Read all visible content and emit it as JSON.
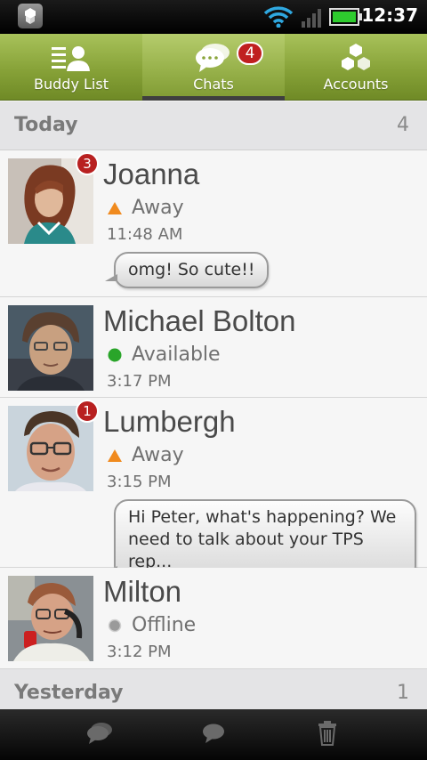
{
  "status_bar": {
    "time": "12:37",
    "icons": [
      "app-notification-icon",
      "wifi-icon",
      "signal-icon",
      "battery-icon"
    ]
  },
  "tabs": [
    {
      "label": "Buddy List",
      "icon": "buddy-list-icon",
      "active": false
    },
    {
      "label": "Chats",
      "icon": "chat-bubbles-icon",
      "active": true,
      "badge": "4"
    },
    {
      "label": "Accounts",
      "icon": "accounts-icon",
      "active": false
    }
  ],
  "sections": {
    "today": {
      "title": "Today",
      "count": "4"
    },
    "yesterday": {
      "title": "Yesterday",
      "count": "1"
    }
  },
  "chats": [
    {
      "name": "Joanna",
      "status": "Away",
      "status_icon": "away-triangle-icon",
      "time": "11:48 AM",
      "unread": "3",
      "last_message": "omg! So cute!!"
    },
    {
      "name": "Michael Bolton",
      "status": "Available",
      "status_icon": "available-dot-icon",
      "time": "3:17 PM",
      "unread": "",
      "last_message": ""
    },
    {
      "name": "Lumbergh",
      "status": "Away",
      "status_icon": "away-triangle-icon",
      "time": "3:15 PM",
      "unread": "1",
      "last_message_line1": "Hi Peter, what's happening? We",
      "last_message_line2": "need to talk about your TPS rep..."
    },
    {
      "name": "Milton",
      "status": "Offline",
      "status_icon": "offline-dot-icon",
      "time": "3:12 PM",
      "unread": "",
      "last_message": ""
    }
  ],
  "bottom_bar": {
    "buttons": [
      "chats-icon",
      "new-chat-icon",
      "delete-trash-icon"
    ]
  },
  "colors": {
    "tab_green": "#87a238",
    "badge_red": "#c02020",
    "away_orange": "#f08a1e",
    "available_green": "#2aa52a",
    "offline_gray": "#9a9a9a"
  }
}
